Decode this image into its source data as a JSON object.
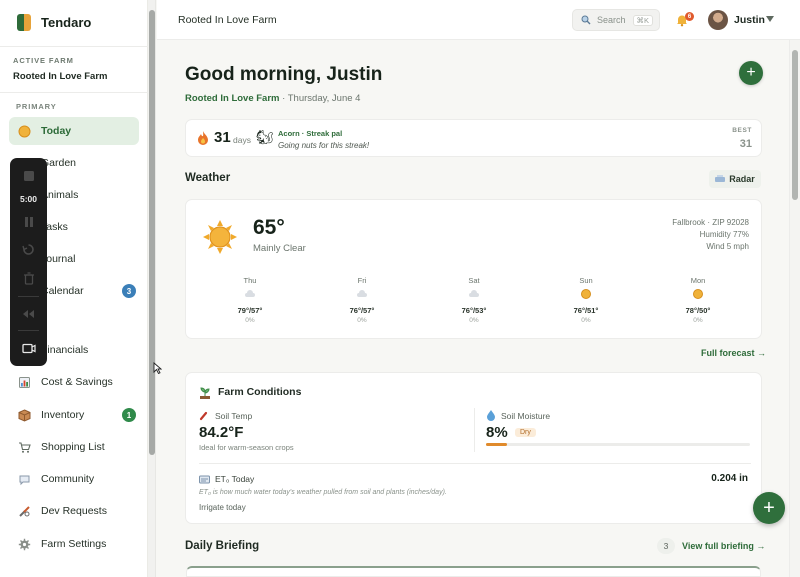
{
  "app": {
    "name": "Tendaro"
  },
  "farm_switcher": {
    "label": "ACTIVE FARM",
    "name": "Rooted In Love Farm"
  },
  "sidebar": {
    "section_label": "PRIMARY",
    "items": [
      {
        "label": "Today",
        "icon": "sun-icon",
        "active": true
      },
      {
        "label": "Garden",
        "icon": "sprout-icon"
      },
      {
        "label": "Animals",
        "icon": "chicken-icon"
      },
      {
        "label": "Tasks",
        "icon": "checklist-icon"
      },
      {
        "label": "Journal",
        "icon": "notebook-icon"
      },
      {
        "label": "Calendar",
        "icon": "calendar-icon",
        "badge": "3"
      },
      {
        "label": "Financials",
        "icon": "money-icon"
      },
      {
        "label": "Cost & Savings",
        "icon": "chart-icon"
      },
      {
        "label": "Inventory",
        "icon": "box-icon",
        "badge": "1"
      },
      {
        "label": "Shopping List",
        "icon": "cart-icon"
      },
      {
        "label": "Community",
        "icon": "chat-icon"
      },
      {
        "label": "Dev Requests",
        "icon": "tools-icon"
      },
      {
        "label": "Farm Settings",
        "icon": "gear-icon"
      }
    ]
  },
  "recorder": {
    "time": "5:00"
  },
  "topbar": {
    "title": "Rooted In Love Farm",
    "search_label": "Search",
    "search_shortcut": "⌘K",
    "notification_count": "6",
    "user_name": "Justin"
  },
  "header": {
    "greeting": "Good morning, Justin",
    "farm_name": "Rooted In Love Farm",
    "date": " · Thursday, June 4"
  },
  "streak": {
    "count": "31",
    "unit": "days",
    "pal_title": "Acorn · Streak pal",
    "pal_note": "Going nuts for this streak!",
    "best_label": "BEST",
    "best_value": "31"
  },
  "weather": {
    "section_title": "Weather",
    "radar_label": "Radar",
    "temp": "65°",
    "condition": "Mainly Clear",
    "location": "Fallbrook · ZIP 92028",
    "humidity": "Humidity 77%",
    "wind": "Wind 5 mph",
    "forecast": [
      {
        "day": "Thu",
        "icon": "cloud-icon",
        "temps": "79°/57°",
        "precip": "0%"
      },
      {
        "day": "Fri",
        "icon": "cloud-icon",
        "temps": "76°/57°",
        "precip": "0%"
      },
      {
        "day": "Sat",
        "icon": "cloud-icon",
        "temps": "76°/53°",
        "precip": "0%"
      },
      {
        "day": "Sun",
        "icon": "sun-icon",
        "temps": "76°/51°",
        "precip": "0%"
      },
      {
        "day": "Mon",
        "icon": "sun-icon",
        "temps": "78°/50°",
        "precip": "0%"
      }
    ],
    "full_forecast_link": "Full forecast →"
  },
  "conditions": {
    "title": "Farm Conditions",
    "soil_temp_label": "Soil Temp",
    "soil_temp_value": "84.2°F",
    "soil_temp_note": "Ideal for warm-season crops",
    "soil_moisture_label": "Soil Moisture",
    "soil_moisture_value": "8%",
    "soil_moisture_fraction": 0.08,
    "soil_moisture_status": "Dry",
    "et_label": "ET₀ Today",
    "et_value": "0.204 in",
    "et_note": "ET₀ is how much water today's weather pulled from soil and plants (inches/day).",
    "et_action": "Irrigate today"
  },
  "briefing": {
    "title": "Daily Briefing",
    "count": "3",
    "link": "View full briefing →"
  },
  "colors": {
    "brand": "#2f6f3c",
    "accent": "#e08a2b",
    "active_bg": "#e3efe3"
  }
}
